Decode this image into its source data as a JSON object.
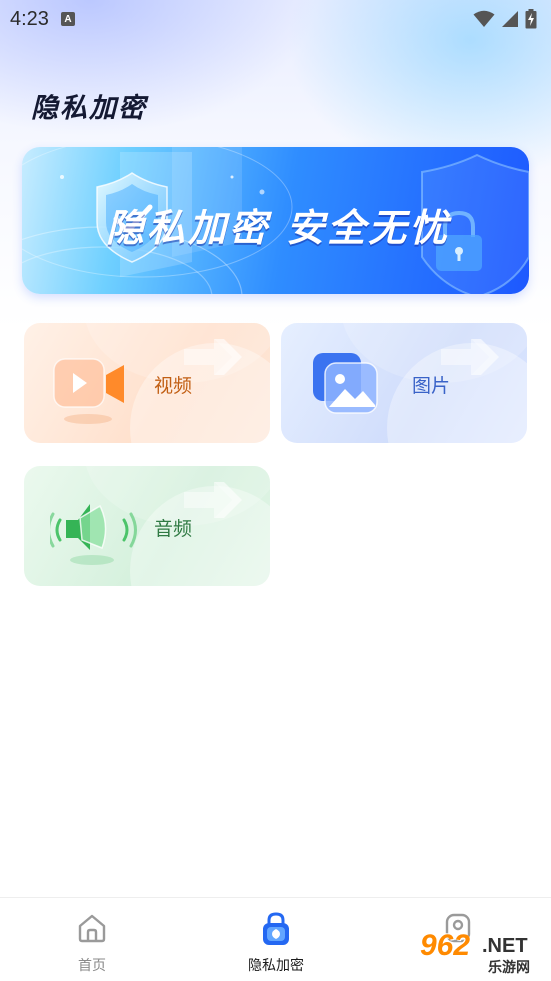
{
  "status_bar": {
    "time": "4:23",
    "notification_glyph": "A"
  },
  "header": {
    "title": "隐私加密"
  },
  "banner": {
    "title": "隐私加密 安全无忧"
  },
  "categories": [
    {
      "label": "视频",
      "icon": "video-camera-icon",
      "accent": "#ff8a3d"
    },
    {
      "label": "图片",
      "icon": "image-gallery-icon",
      "accent": "#3b73f0"
    },
    {
      "label": "音频",
      "icon": "speaker-icon",
      "accent": "#4cc46a"
    }
  ],
  "bottom_nav": {
    "items": [
      {
        "label": "首页",
        "icon": "home-icon",
        "active": false
      },
      {
        "label": "隐私加密",
        "icon": "lock-icon",
        "active": true
      },
      {
        "label": "",
        "icon": "profile-icon",
        "active": false
      }
    ]
  },
  "watermark": {
    "number": "962",
    "domain": ".NET",
    "site_name": "乐游网"
  }
}
